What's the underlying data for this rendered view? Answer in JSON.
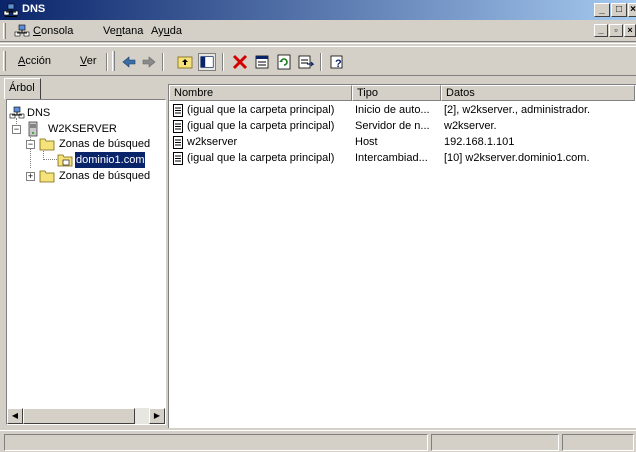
{
  "window": {
    "title": "DNS"
  },
  "menubar": {
    "items": [
      {
        "label": "Consola",
        "key": "C",
        "rest": "onsola"
      },
      {
        "label": "Ventana",
        "pre": "Ve",
        "key": "n",
        "rest": "tana"
      },
      {
        "label": "Ayuda",
        "pre": "Ay",
        "key": "u",
        "rest": "da"
      }
    ]
  },
  "action_menu": {
    "items": [
      {
        "label": "Acción",
        "key": "A",
        "rest": "cción"
      },
      {
        "label": "Ver",
        "key": "V",
        "rest": "er"
      }
    ]
  },
  "tree": {
    "tab_label": "Árbol",
    "nodes": [
      {
        "label": "DNS"
      },
      {
        "label": "W2KSERVER"
      },
      {
        "label": "Zonas de búsqued"
      },
      {
        "label": "dominio1.com"
      },
      {
        "label": "Zonas de búsqued"
      }
    ]
  },
  "list": {
    "columns": [
      "Nombre",
      "Tipo",
      "Datos"
    ],
    "rows": [
      {
        "name": "(igual que la carpeta principal)",
        "type": "Inicio de auto...",
        "data": "[2], w2kserver., administrador."
      },
      {
        "name": "(igual que la carpeta principal)",
        "type": "Servidor de n...",
        "data": "w2kserver."
      },
      {
        "name": "w2kserver",
        "type": "Host",
        "data": "192.168.1.101"
      },
      {
        "name": "(igual que la carpeta principal)",
        "type": "Intercambiad...",
        "data": "[10] w2kserver.dominio1.com."
      }
    ]
  },
  "colors": {
    "title_active": "#0a246a",
    "title_gradient_end": "#a6caf0",
    "face": "#d4d0c8",
    "selection": "#0a246a",
    "delete_red": "#d40000"
  }
}
